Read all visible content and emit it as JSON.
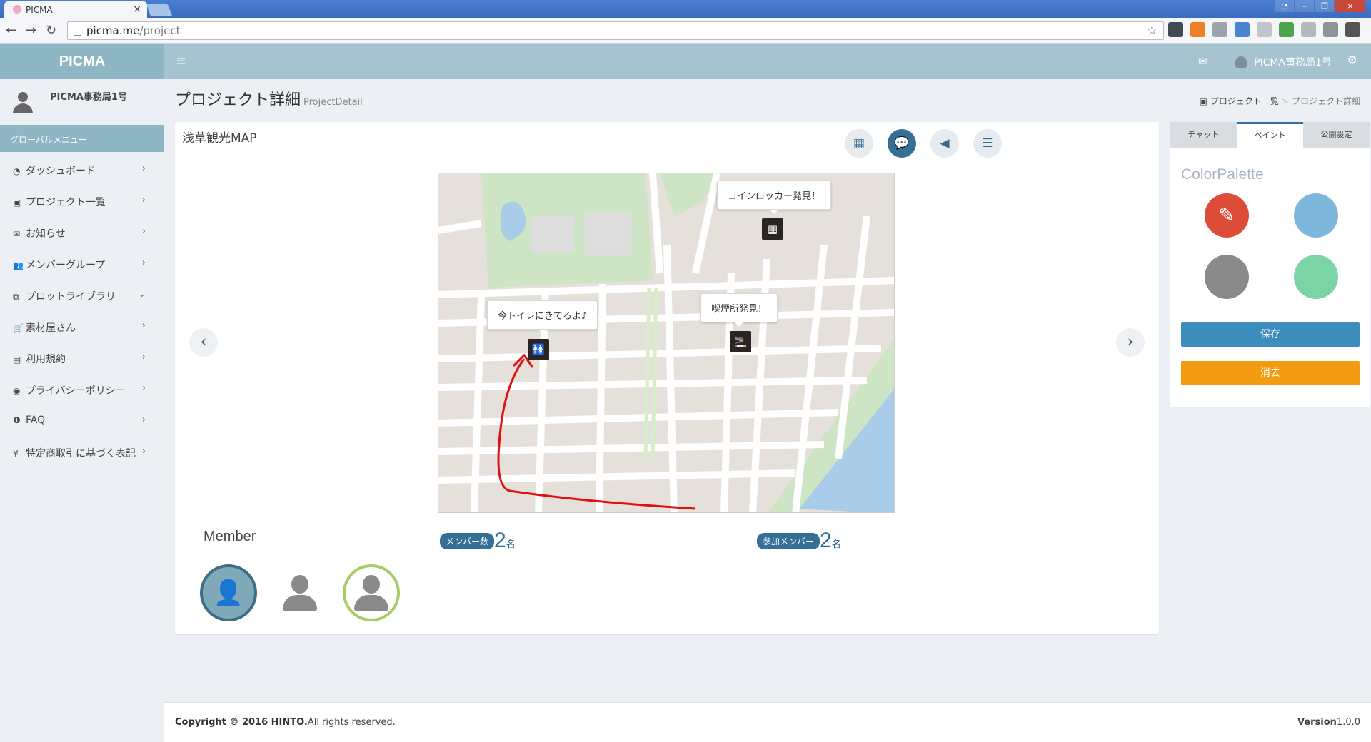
{
  "browser": {
    "tab_title": "PICMA",
    "url_domain": "picma.me",
    "url_path": "/project"
  },
  "app": {
    "brand": "PICMA",
    "header_user": "PICMA事務局1号"
  },
  "sidebar": {
    "user_name": "PICMA事務局1号",
    "menu_header": "グローバルメニュー",
    "items": [
      {
        "label": "ダッシュボード",
        "icon": "dashboard-icon",
        "glyph": "◔",
        "chevron": "›"
      },
      {
        "label": "プロジェクト一覧",
        "icon": "image-icon",
        "glyph": "▣",
        "chevron": "›"
      },
      {
        "label": "お知らせ",
        "icon": "envelope-icon",
        "glyph": "✉",
        "chevron": "›"
      },
      {
        "label": "メンバーグループ",
        "icon": "users-icon",
        "glyph": "👥",
        "chevron": "›"
      },
      {
        "label": "プロットライブラリ",
        "icon": "clipboard-icon",
        "glyph": "⧉",
        "chevron": "⌄"
      },
      {
        "label": "素材屋さん",
        "icon": "cart-icon",
        "glyph": "🛒",
        "chevron": "›"
      },
      {
        "label": "利用規約",
        "icon": "book-icon",
        "glyph": "▤",
        "chevron": "›"
      },
      {
        "label": "プライバシーポリシー",
        "icon": "lock-icon",
        "glyph": "◉",
        "chevron": "›"
      },
      {
        "label": "FAQ",
        "icon": "info-icon",
        "glyph": "❶",
        "chevron": "›"
      },
      {
        "label": "特定商取引に基づく表記",
        "icon": "yen-icon",
        "glyph": "¥",
        "chevron": "›"
      }
    ]
  },
  "page": {
    "title": "プロジェクト詳細",
    "subtitle": "ProjectDetail",
    "breadcrumb": {
      "first": "プロジェクト一覧",
      "current": "プロジェクト詳細"
    }
  },
  "project": {
    "title": "浅草観光MAP",
    "map_notes": [
      {
        "text": "コインロッカー発見！",
        "icon": "locker-icon",
        "glyph": "▦"
      },
      {
        "text": "今トイレにきてるよ♪",
        "icon": "restroom-icon",
        "glyph": "🚻"
      },
      {
        "text": "喫煙所発見！",
        "icon": "smoking-icon",
        "glyph": "🚬"
      }
    ],
    "member_title": "Member",
    "member_count_label": "メンバー数",
    "member_count": "2",
    "participant_label": "参加メンバー",
    "participant_count": "2",
    "count_unit": "名"
  },
  "panel": {
    "tabs": [
      "チャット",
      "ペイント",
      "公開設定"
    ],
    "active_tab": "ペイント",
    "palette_title": "ColorPalette",
    "colors": [
      "#dd4b39",
      "#7db7dc",
      "#8a8a8a",
      "#7bd3a6"
    ],
    "save_label": "保存",
    "clear_label": "消去"
  },
  "footer": {
    "copyright_bold": "Copyright © 2016 HINTO.",
    "copyright_rest": "All rights reserved.",
    "version_label": "Version",
    "version": "1.0.0"
  }
}
